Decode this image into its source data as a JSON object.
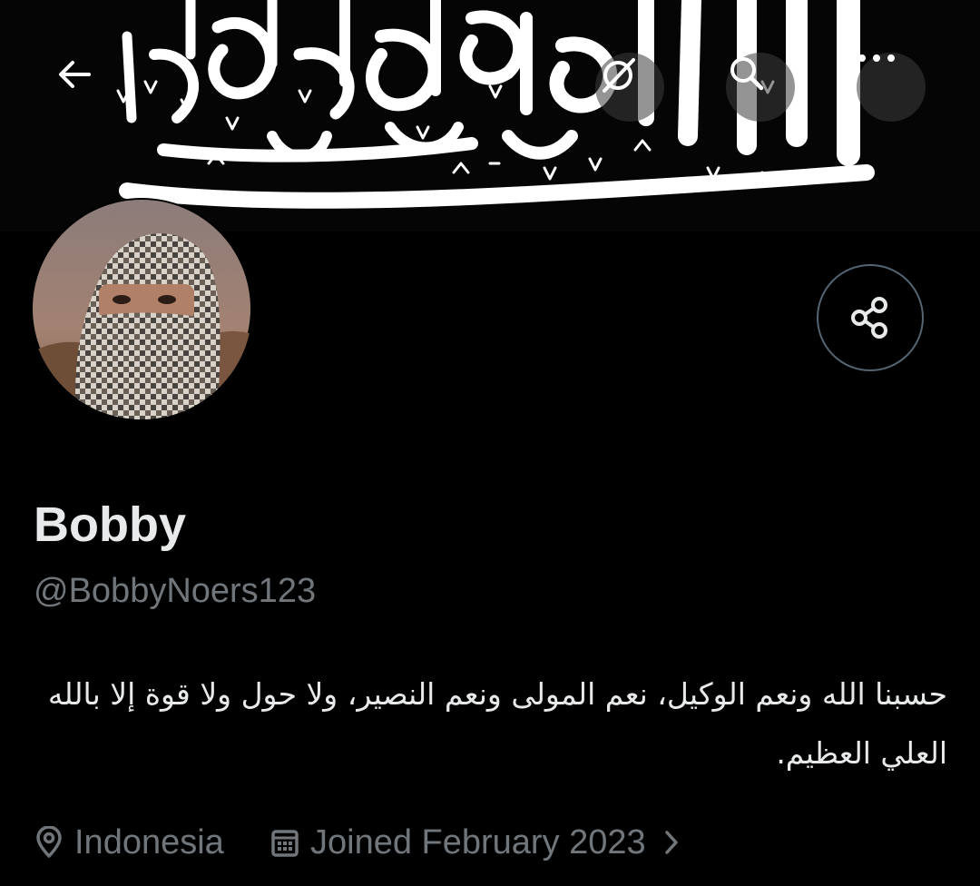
{
  "profile": {
    "display_name": "Bobby",
    "handle": "@BobbyNoers123",
    "bio": "حسبنا الله ونعم الوكيل، نعم المولى ونعم النصير، ولا حول ولا قوة إلا بالله العلي العظيم.",
    "location": "Indonesia",
    "joined": "Joined February 2023"
  },
  "header": {
    "icons": [
      "back-arrow-icon",
      "grok-icon",
      "search-icon",
      "more-icon"
    ]
  },
  "icons": {
    "share": "share-icon",
    "location": "location-pin-icon",
    "joined": "calendar-icon",
    "joined_chevron": "chevron-right-icon"
  },
  "colors": {
    "background": "#000000",
    "primary_text": "#e7e9ea",
    "secondary_text": "#71767b",
    "border": "#536471"
  }
}
